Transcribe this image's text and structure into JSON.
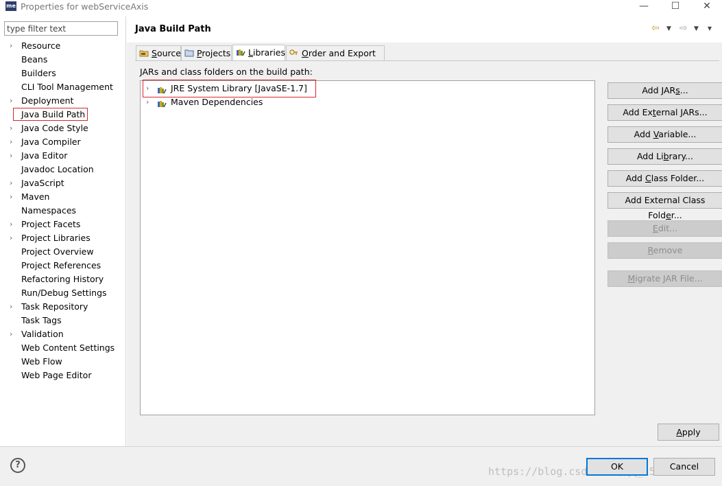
{
  "window": {
    "app_icon_text": "me",
    "title": "Properties for webServiceAxis",
    "minimize_glyph": "—",
    "maximize_glyph": "☐",
    "close_glyph": "✕"
  },
  "filter": {
    "placeholder": "type filter text",
    "value": ""
  },
  "sidebar": {
    "items": [
      {
        "label": "Resource",
        "expandable": true
      },
      {
        "label": "Beans",
        "expandable": false
      },
      {
        "label": "Builders",
        "expandable": false
      },
      {
        "label": "CLI Tool Management",
        "expandable": false
      },
      {
        "label": "Deployment",
        "expandable": true
      },
      {
        "label": "Java Build Path",
        "expandable": false,
        "selected": true
      },
      {
        "label": "Java Code Style",
        "expandable": true
      },
      {
        "label": "Java Compiler",
        "expandable": true
      },
      {
        "label": "Java Editor",
        "expandable": true
      },
      {
        "label": "Javadoc Location",
        "expandable": false
      },
      {
        "label": "JavaScript",
        "expandable": true
      },
      {
        "label": "Maven",
        "expandable": true
      },
      {
        "label": "Namespaces",
        "expandable": false
      },
      {
        "label": "Project Facets",
        "expandable": true
      },
      {
        "label": "Project Libraries",
        "expandable": true
      },
      {
        "label": "Project Overview",
        "expandable": false
      },
      {
        "label": "Project References",
        "expandable": false
      },
      {
        "label": "Refactoring History",
        "expandable": false
      },
      {
        "label": "Run/Debug Settings",
        "expandable": false
      },
      {
        "label": "Task Repository",
        "expandable": true
      },
      {
        "label": "Task Tags",
        "expandable": false
      },
      {
        "label": "Validation",
        "expandable": true
      },
      {
        "label": "Web Content Settings",
        "expandable": false
      },
      {
        "label": "Web Flow",
        "expandable": false
      },
      {
        "label": "Web Page Editor",
        "expandable": false
      }
    ]
  },
  "header": {
    "title": "Java Build Path",
    "back_glyph": "⇦",
    "forward_glyph": "⇨",
    "dropdown_glyph": "▼",
    "view_menu_glyph": "▾"
  },
  "tabs": [
    {
      "label": "Source",
      "mnemonic_index": 0,
      "icon": "source-folder-icon",
      "active": false
    },
    {
      "label": "Projects",
      "mnemonic_index": 0,
      "icon": "projects-icon",
      "active": false
    },
    {
      "label": "Libraries",
      "mnemonic_index": 0,
      "icon": "libraries-icon",
      "active": true
    },
    {
      "label": "Order and Export",
      "mnemonic_index": 0,
      "icon": "order-export-icon",
      "active": false
    }
  ],
  "libraries_panel": {
    "label": "JARs and class folders on the build path:",
    "entries": [
      {
        "label": "JRE System Library [JavaSE-1.7]",
        "icon": "library-icon",
        "highlighted": true
      },
      {
        "label": "Maven Dependencies",
        "icon": "library-icon",
        "highlighted": false
      }
    ]
  },
  "buttons": {
    "add_jars": "Add JARs...",
    "add_external_jars": "Add External JARs...",
    "add_variable": "Add Variable...",
    "add_library": "Add Library...",
    "add_class_folder": "Add Class Folder...",
    "add_external_class_folder": "Add External Class Folder...",
    "edit": "Edit...",
    "remove": "Remove",
    "migrate_jar": "Migrate JAR File...",
    "apply": "Apply",
    "ok": "OK",
    "cancel": "Cancel"
  },
  "footer": {
    "help_glyph": "?",
    "watermark": "https://blog.csdn.net/qq_15072912"
  },
  "colors": {
    "selection_outline": "#d9262c",
    "default_button_border": "#0078d7",
    "panel_background": "#f0f0f0"
  }
}
